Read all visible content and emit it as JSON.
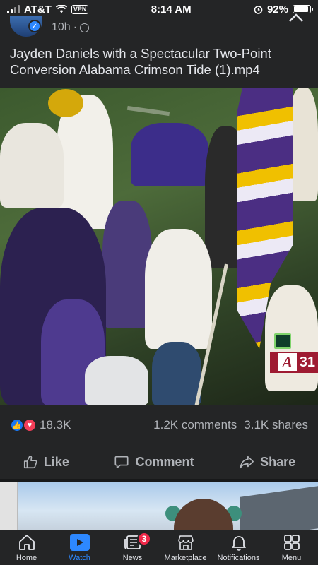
{
  "status_bar": {
    "carrier": "AT&T",
    "vpn": "VPN",
    "time": "8:14 AM",
    "battery": "92%",
    "battery_level": 0.92
  },
  "post": {
    "age": "10h",
    "separator": "·",
    "title": "Jayden Daniels with a Spectacular Two-Point Conversion Alabama Crimson Tide (1).mp4",
    "score_bug": {
      "logo": "A",
      "score": "31"
    }
  },
  "engagement": {
    "reactions_count": "18.3K",
    "comments": "1.2K comments",
    "shares": "3.1K shares"
  },
  "actions": {
    "like": "Like",
    "comment": "Comment",
    "share": "Share"
  },
  "bottom_nav": {
    "items": [
      {
        "label": "Home",
        "icon": "home-icon"
      },
      {
        "label": "Watch",
        "icon": "watch-icon",
        "active": true
      },
      {
        "label": "News",
        "icon": "news-icon",
        "badge": "3"
      },
      {
        "label": "Marketplace",
        "icon": "marketplace-icon"
      },
      {
        "label": "Notifications",
        "icon": "bell-icon"
      },
      {
        "label": "Menu",
        "icon": "menu-grid-icon"
      }
    ]
  },
  "colors": {
    "background": "#242526",
    "accent": "#2d88ff",
    "like_blue": "#1877f2",
    "love_red": "#f33e58",
    "badge_red": "#f02849",
    "alabama_crimson": "#9e1b32",
    "lsu_purple": "#4b2e83",
    "lsu_gold": "#f0c000"
  }
}
